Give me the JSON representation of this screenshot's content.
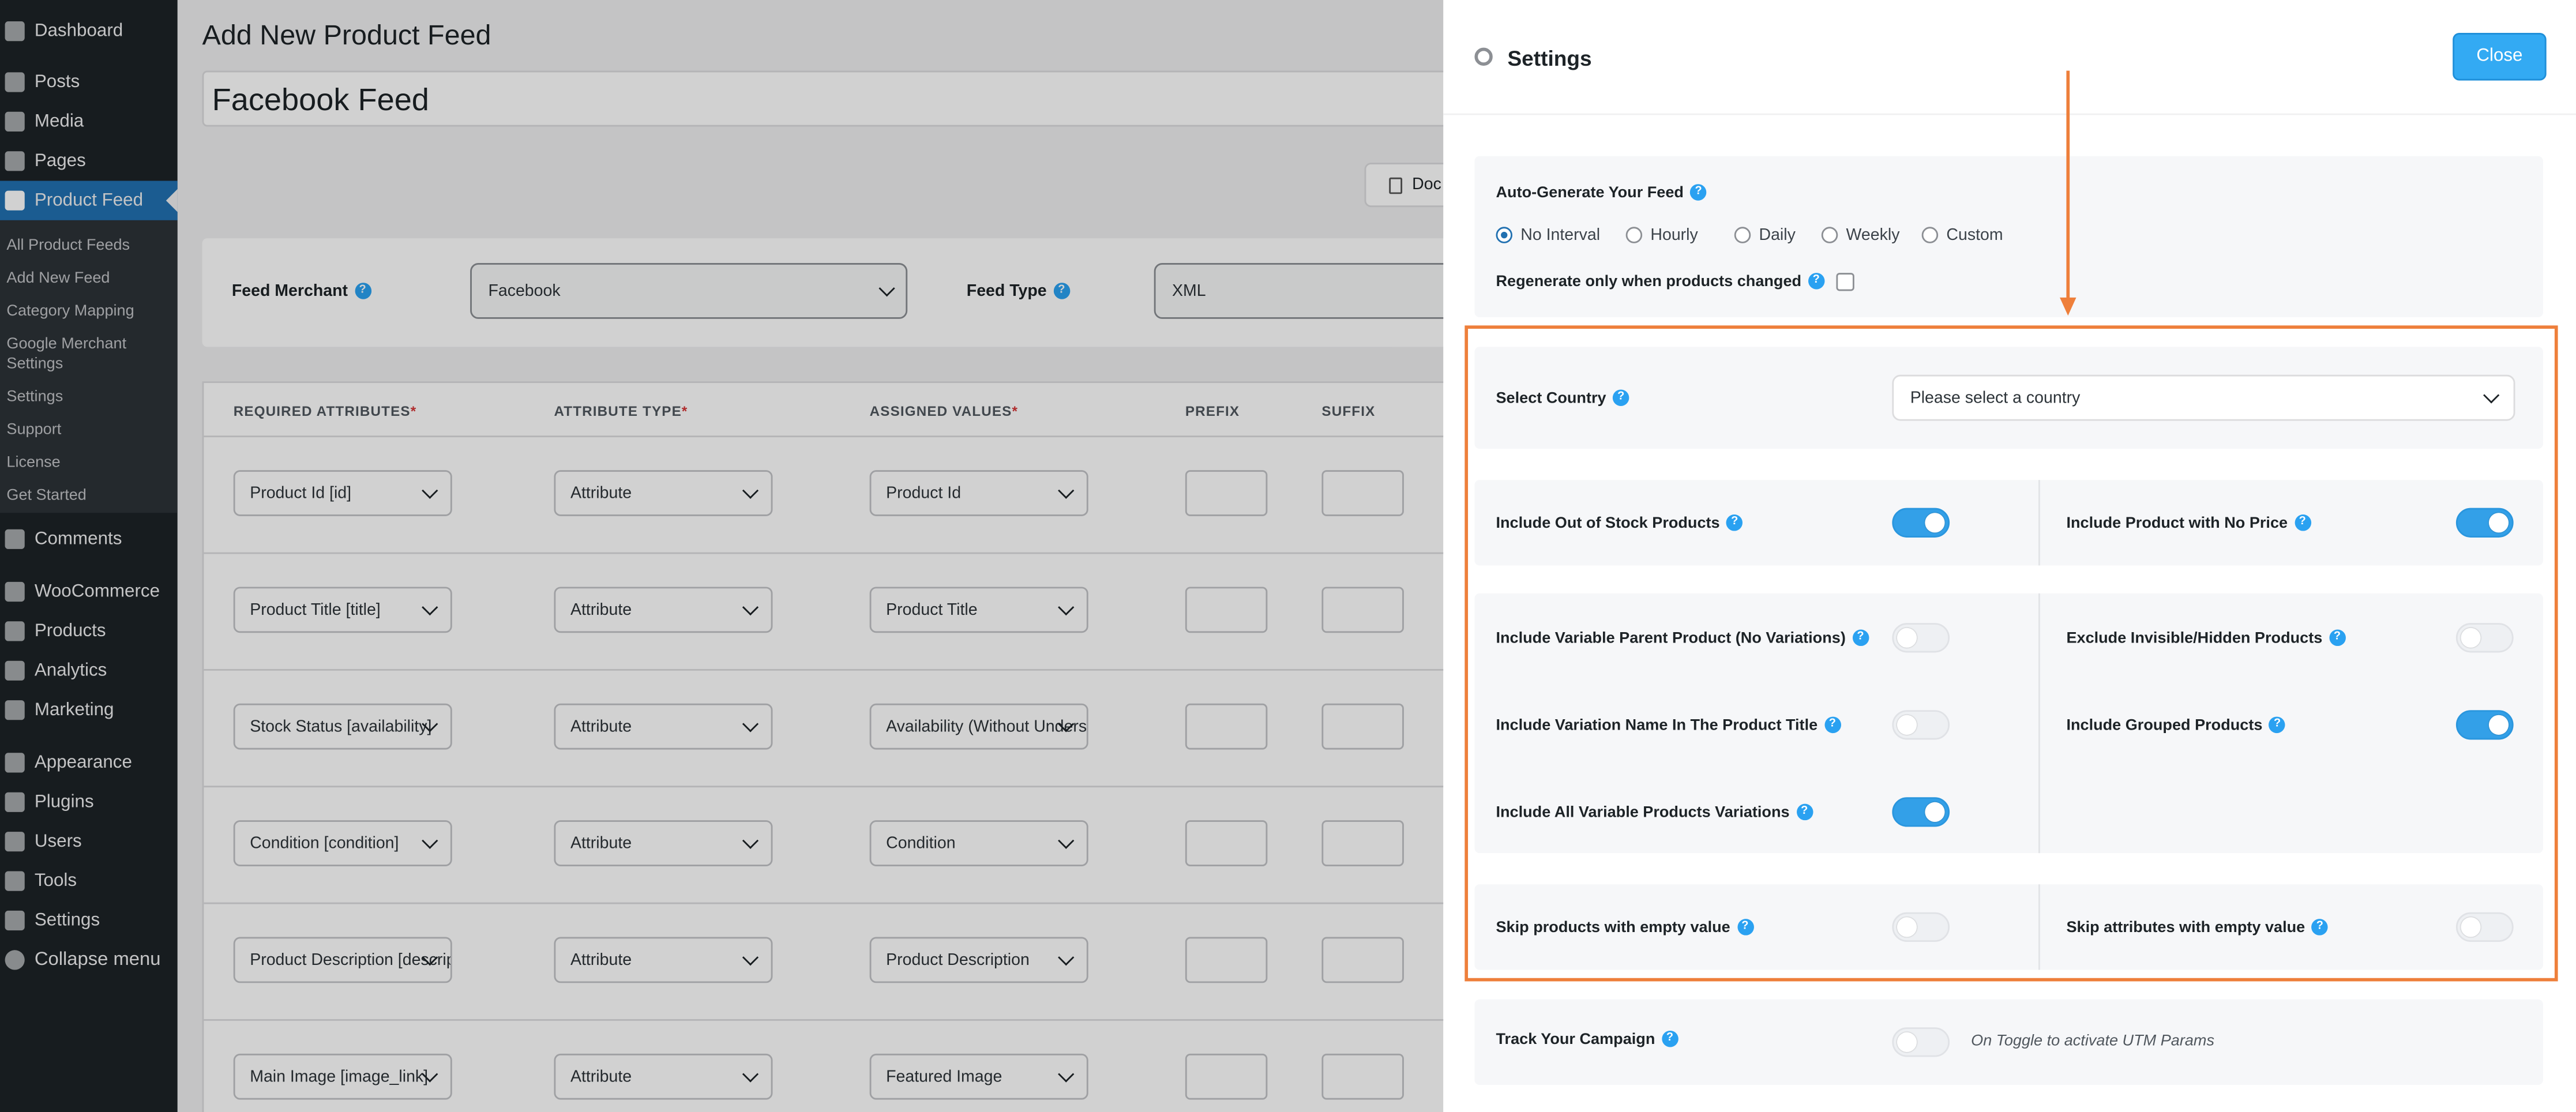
{
  "sidebar": {
    "items": [
      {
        "label": "Dashboard",
        "icon": "dashboard-icon"
      },
      {
        "label": "Posts",
        "icon": "pin-icon"
      },
      {
        "label": "Media",
        "icon": "media-icon"
      },
      {
        "label": "Pages",
        "icon": "pages-icon"
      },
      {
        "label": "Product Feed",
        "icon": "cart-icon"
      },
      {
        "label": "Comments",
        "icon": "comment-icon"
      },
      {
        "label": "WooCommerce",
        "icon": "woocommerce-icon"
      },
      {
        "label": "Products",
        "icon": "products-icon"
      },
      {
        "label": "Analytics",
        "icon": "analytics-icon"
      },
      {
        "label": "Marketing",
        "icon": "megaphone-icon"
      },
      {
        "label": "Appearance",
        "icon": "brush-icon"
      },
      {
        "label": "Plugins",
        "icon": "plugin-icon"
      },
      {
        "label": "Users",
        "icon": "user-icon"
      },
      {
        "label": "Tools",
        "icon": "wrench-icon"
      },
      {
        "label": "Settings",
        "icon": "settings-icon"
      }
    ],
    "submenu": [
      "All Product Feeds",
      "Add New Feed",
      "Category Mapping",
      "Google Merchant",
      "Settings",
      "Settings",
      "Support",
      "License",
      "Get Started"
    ],
    "collapse": "Collapse menu"
  },
  "main": {
    "title": "Add New Product Feed",
    "feed_name": "Facebook Feed",
    "doc_button": "Doc",
    "feed_merchant_label": "Feed Merchant",
    "feed_merchant_value": "Facebook",
    "feed_type_label": "Feed Type",
    "feed_type_value": "XML",
    "table": {
      "headers": [
        "REQUIRED ATTRIBUTES",
        "ATTRIBUTE TYPE",
        "ASSIGNED VALUES",
        "PREFIX",
        "SUFFIX"
      ],
      "rows": [
        {
          "attribute": "Product Id [id]",
          "type": "Attribute",
          "value": "Product Id"
        },
        {
          "attribute": "Product Title [title]",
          "type": "Attribute",
          "value": "Product Title"
        },
        {
          "attribute": "Stock Status [availability]",
          "type": "Attribute",
          "value": "Availability (Without Underscore)"
        },
        {
          "attribute": "Condition [condition]",
          "type": "Attribute",
          "value": "Condition"
        },
        {
          "attribute": "Product Description [description]",
          "type": "Attribute",
          "value": "Product Description"
        },
        {
          "attribute": "Main Image [image_link]",
          "type": "Attribute",
          "value": "Featured Image"
        }
      ]
    }
  },
  "settings": {
    "title": "Settings",
    "close": "Close",
    "auto_generate": {
      "label": "Auto-Generate Your Feed",
      "options": [
        "No Interval",
        "Hourly",
        "Daily",
        "Weekly",
        "Custom"
      ],
      "selected": "No Interval",
      "regenerate_label": "Regenerate only when products changed",
      "regenerate_checked": false
    },
    "country": {
      "label": "Select Country",
      "placeholder": "Please select a country"
    },
    "toggles": {
      "out_of_stock": {
        "label": "Include Out of Stock Products",
        "on": true
      },
      "no_price": {
        "label": "Include Product with No Price",
        "on": true
      },
      "variable_parent": {
        "label": "Include Variable Parent Product (No Variations)",
        "on": false
      },
      "exclude_hidden": {
        "label": "Exclude Invisible/Hidden Products",
        "on": false
      },
      "variation_name": {
        "label": "Include Variation Name In The Product Title",
        "on": false
      },
      "grouped": {
        "label": "Include Grouped Products",
        "on": true
      },
      "all_variations": {
        "label": "Include All Variable Products Variations",
        "on": true
      },
      "skip_products": {
        "label": "Skip products with empty value",
        "on": false
      },
      "skip_attributes": {
        "label": "Skip attributes with empty value",
        "on": false
      },
      "track_campaign": {
        "label": "Track Your Campaign",
        "on": false,
        "note": "On Toggle to activate UTM Params"
      }
    }
  },
  "colors": {
    "accent": "#2271b1",
    "toggle_on": "#33a0e8",
    "highlight": "#ee7f3b",
    "sidebar_bg": "#1d2327"
  }
}
